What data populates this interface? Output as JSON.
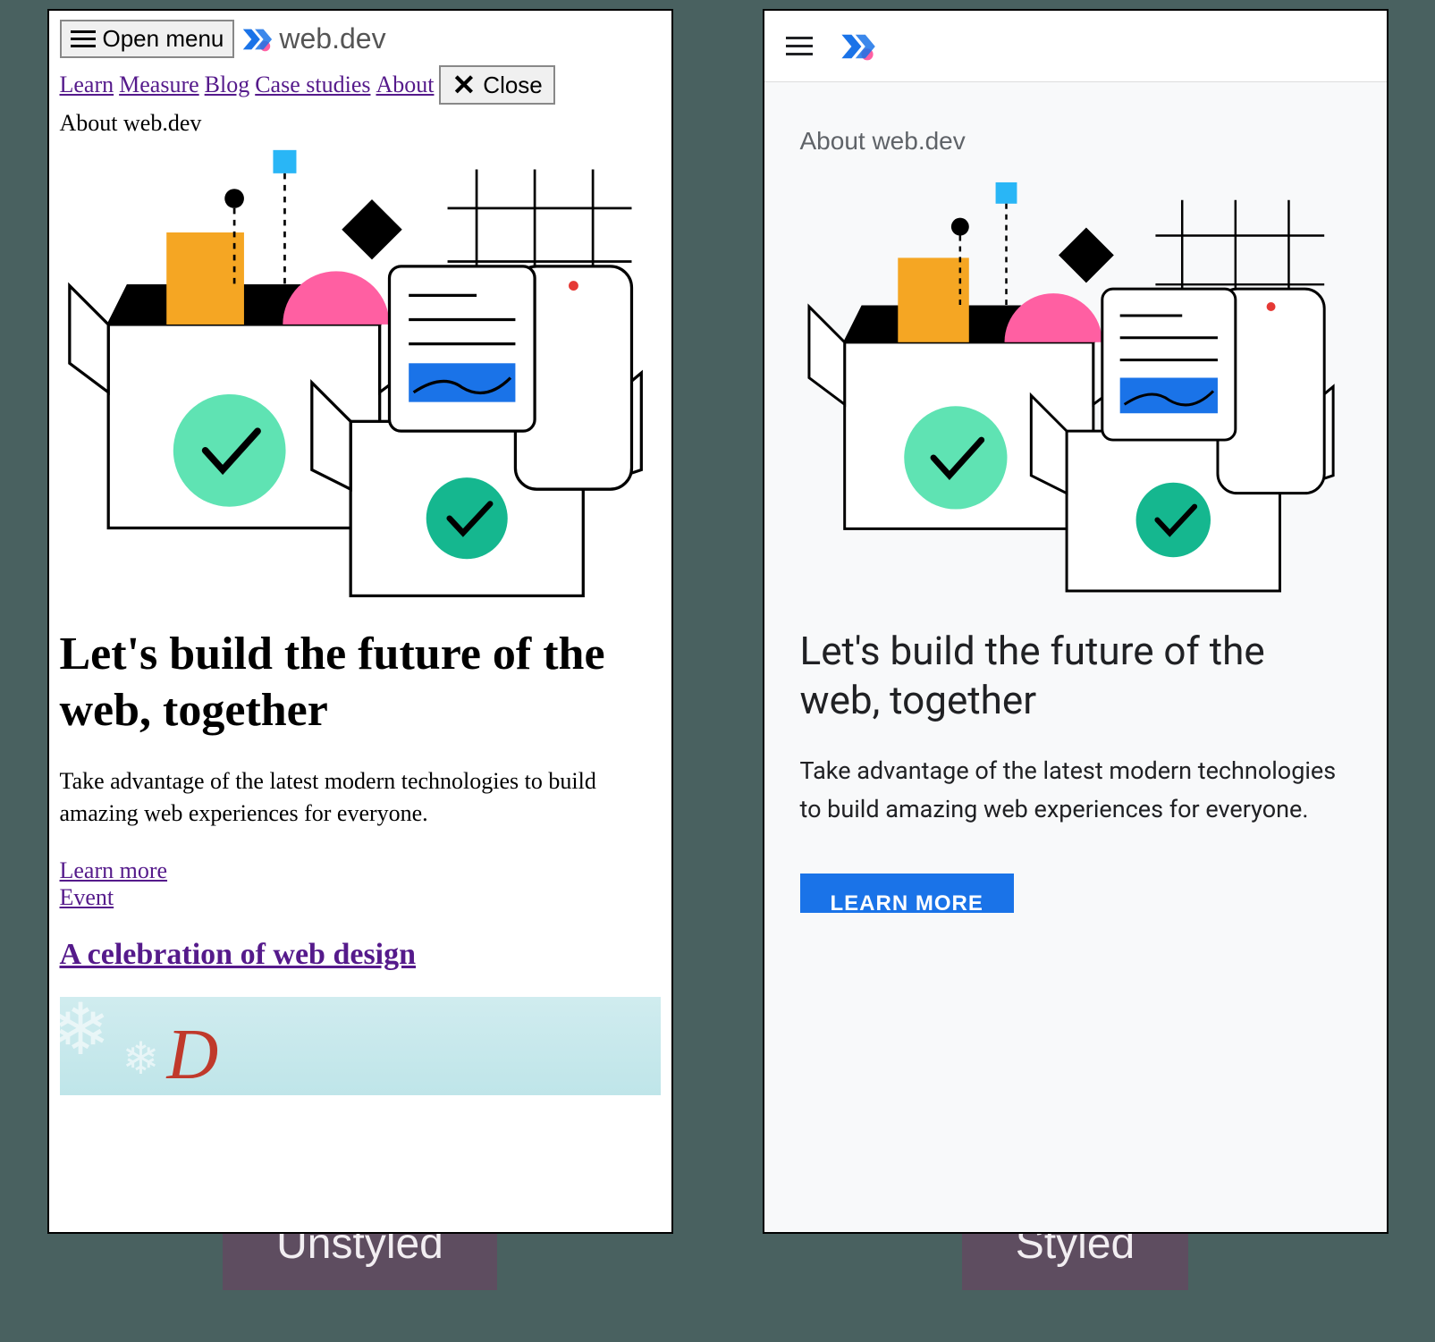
{
  "brand": {
    "name": "web.dev"
  },
  "unstyled": {
    "open_menu_label": "Open menu",
    "close_label": "Close",
    "nav": [
      "Learn",
      "Measure",
      "Blog",
      "Case studies",
      "About"
    ],
    "about_label": "About web.dev",
    "headline": "Let's build the future of the web, together",
    "subhead": "Take advantage of the latest modern technologies to build amazing web experiences for everyone.",
    "learn_more_label": "Learn more",
    "event_label": "Event",
    "event_headline": "A celebration of web design"
  },
  "styled": {
    "about_label": "About web.dev",
    "headline": "Let's build the future of the web, together",
    "subhead": "Take advantage of the latest modern technologies to build amazing web experiences for everyone.",
    "cta_label": "LEARN MORE"
  },
  "captions": {
    "left": "Unstyled",
    "right": "Styled"
  }
}
